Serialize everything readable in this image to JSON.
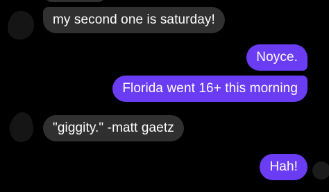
{
  "conversation": {
    "messages": [
      {
        "sender": "them",
        "text": "my second one is saturday!"
      },
      {
        "sender": "me",
        "text": "Noyce."
      },
      {
        "sender": "me",
        "text": "Florida went 16+ this morning"
      },
      {
        "sender": "them",
        "text": "\"giggity.\" -matt gaetz"
      },
      {
        "sender": "me",
        "text": "Hah!"
      }
    ]
  },
  "colors": {
    "background": "#000000",
    "incoming_bubble": "#303030",
    "outgoing_bubble": "#6a3cf4",
    "text": "#ffffff"
  },
  "icons": {
    "contact_avatar": "avatar-silhouette-icon",
    "read_receipt": "read-receipt-avatar-icon"
  }
}
